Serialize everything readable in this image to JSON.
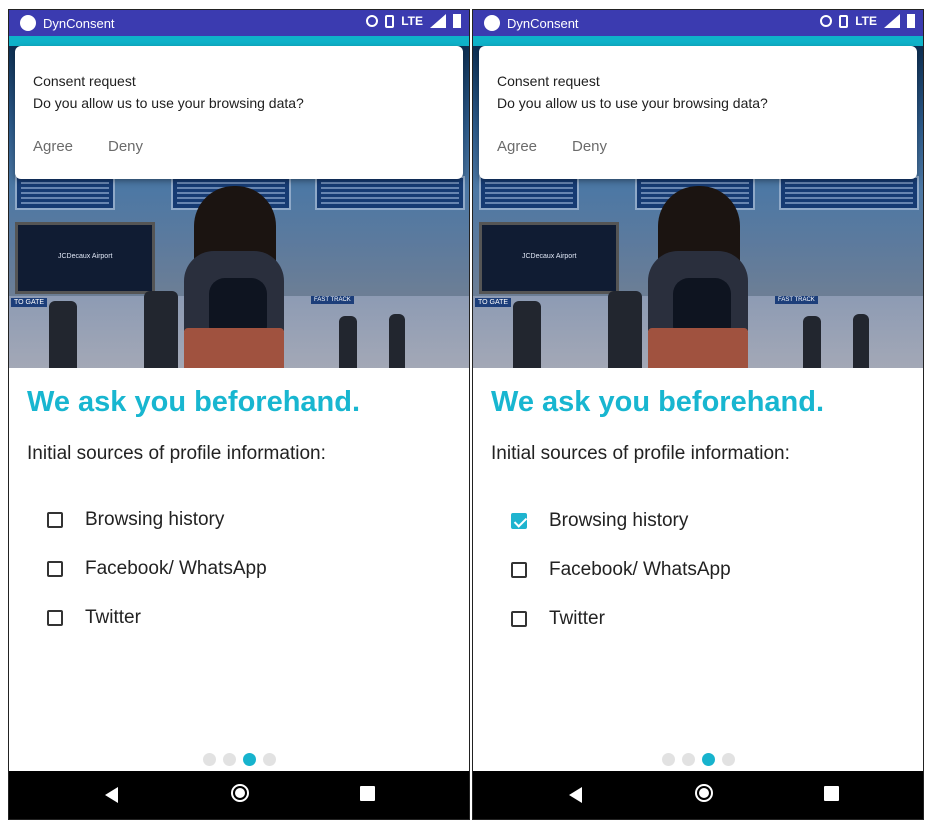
{
  "screens": [
    {
      "status_bar": {
        "app_name": "DynConsent",
        "network": "LTE"
      },
      "notification": {
        "title": "Consent request",
        "body": "Do you allow us to use your browsing data?",
        "agree_label": "Agree",
        "deny_label": "Deny"
      },
      "hero": {
        "tv_text": "JCDecaux Airport",
        "gate_sign": "TO GATE",
        "fast_track_sign": "FAST TRACK"
      },
      "headline": "We ask you beforehand.",
      "subheading": "Initial sources of profile information:",
      "options": [
        {
          "label": "Browsing history",
          "checked": false
        },
        {
          "label": "Facebook/ WhatsApp",
          "checked": false
        },
        {
          "label": "Twitter",
          "checked": false
        }
      ],
      "page_indicator": {
        "total": 4,
        "active": 3
      }
    },
    {
      "status_bar": {
        "app_name": "DynConsent",
        "network": "LTE"
      },
      "notification": {
        "title": "Consent request",
        "body": "Do you allow us to use your browsing data?",
        "agree_label": "Agree",
        "deny_label": "Deny"
      },
      "hero": {
        "tv_text": "JCDecaux Airport",
        "gate_sign": "TO GATE",
        "fast_track_sign": "FAST TRACK"
      },
      "headline": "We ask you beforehand.",
      "subheading": "Initial sources of profile information:",
      "options": [
        {
          "label": "Browsing history",
          "checked": true
        },
        {
          "label": "Facebook/ WhatsApp",
          "checked": false
        },
        {
          "label": "Twitter",
          "checked": false
        }
      ],
      "page_indicator": {
        "total": 4,
        "active": 3
      }
    }
  ],
  "colors": {
    "status_bar": "#3b3bb0",
    "accent": "#18b6d0",
    "nav_bar": "#000000"
  }
}
